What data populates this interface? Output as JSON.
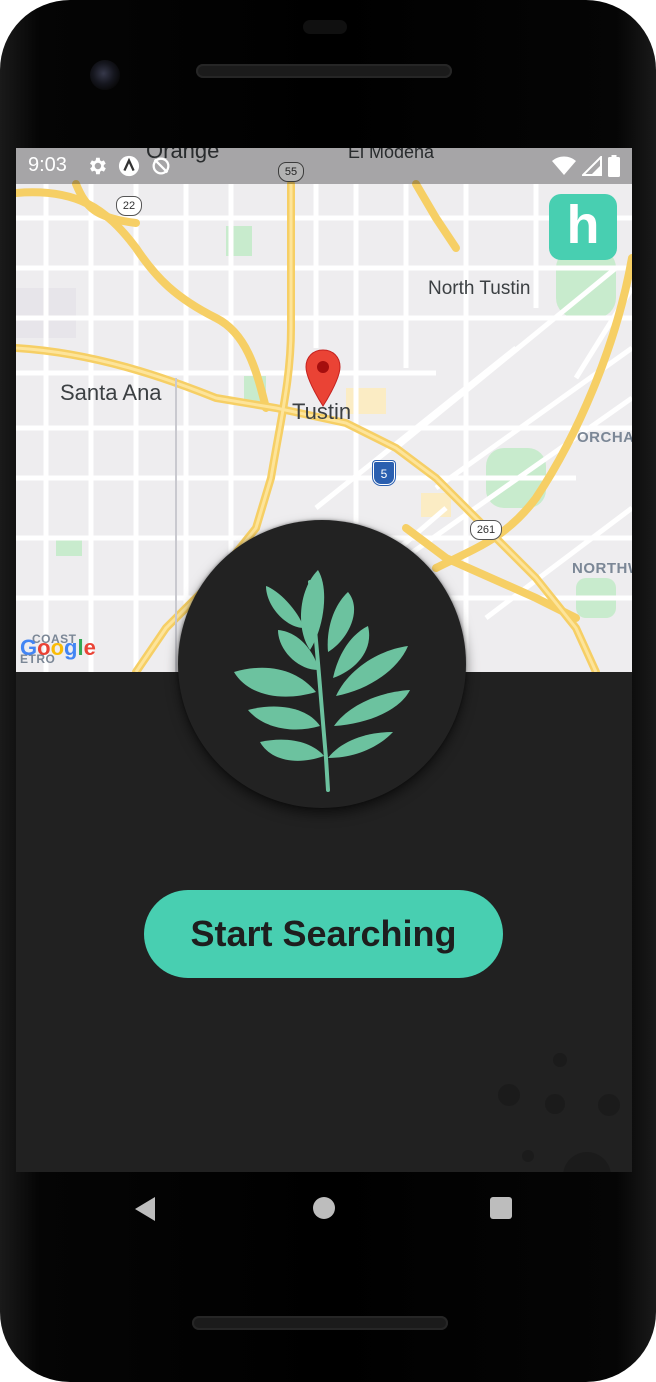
{
  "status_bar": {
    "time": "9:03",
    "left_icons": [
      "gear-icon",
      "a-circle-icon",
      "no-sync-icon"
    ],
    "right_icons": [
      "wifi-icon",
      "signal-icon",
      "battery-icon"
    ]
  },
  "map": {
    "place_labels": [
      "Santa Ana",
      "Tustin",
      "North Tustin",
      "Orange",
      "El Modena"
    ],
    "edge_labels": [
      "ORCHAR",
      "NORTHW",
      "COAST",
      "ETRO"
    ],
    "highway_shields": [
      "22",
      "55",
      "5",
      "261"
    ],
    "attribution": "Google",
    "pin_icon": "map-pin-icon"
  },
  "app_logo": {
    "letter": "h",
    "color": "#48cfb1"
  },
  "plant_icon": "leafy-branch-icon",
  "start_button": {
    "label": "Start Searching",
    "color": "#48cfb1"
  },
  "nav_bar": {
    "icons": [
      "back-icon",
      "home-icon",
      "recents-icon"
    ]
  },
  "colors": {
    "accent": "#48cfb1",
    "background": "#212121",
    "road": "#f9d66b",
    "map": "#eeedef"
  }
}
